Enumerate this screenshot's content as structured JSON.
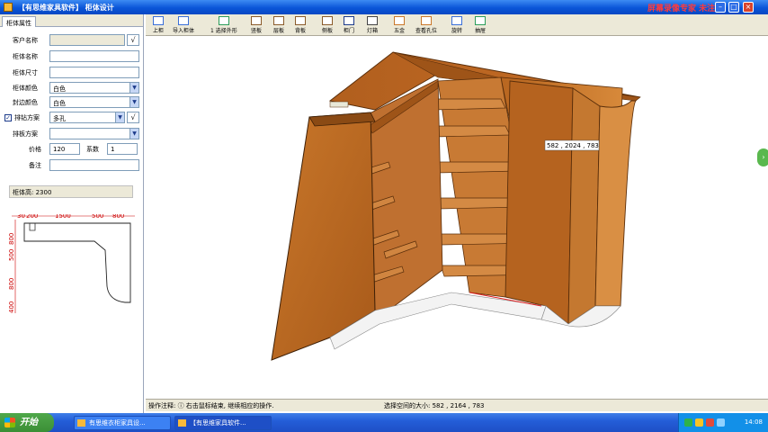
{
  "window": {
    "title": "【有思维家具软件】  柜体设计",
    "watermark": "屏幕录像专家 未注册"
  },
  "left_panel": {
    "tab": "柜体属性",
    "fields": {
      "customer_name": {
        "label": "客户名称",
        "value": ""
      },
      "cabinet_name": {
        "label": "柜体名称",
        "value": ""
      },
      "cabinet_size": {
        "label": "柜体尺寸",
        "value": ""
      },
      "cabinet_color": {
        "label": "柜体颜色",
        "value": "白色"
      },
      "trim_color": {
        "label": "封边颜色",
        "value": "白色"
      },
      "hole_mode": {
        "label": "排钻方案",
        "value": "多孔"
      },
      "sort_scheme": {
        "label": "排板方案",
        "value": ""
      },
      "price": {
        "label": "价格",
        "value": "120"
      },
      "coefficient": {
        "label": "系数",
        "value": "1"
      },
      "remark": {
        "label": "备注",
        "value": ""
      }
    },
    "cabinet_height": "柜体高: 2300",
    "floorplan": {
      "top_dims": [
        "30",
        "200",
        "1500",
        "500",
        "800"
      ],
      "left_dims": [
        "800",
        "500",
        "800",
        "400"
      ]
    }
  },
  "toolbar": [
    {
      "id": "prev",
      "label": "上柜"
    },
    {
      "id": "import",
      "label": "导入柜体"
    },
    {
      "id": "outline",
      "label": "1 选择外形"
    },
    {
      "id": "partition",
      "label": "竖板"
    },
    {
      "id": "shelf",
      "label": "层板"
    },
    {
      "id": "back",
      "label": "背板"
    },
    {
      "id": "side",
      "label": "侧板"
    },
    {
      "id": "door",
      "label": "柜门"
    },
    {
      "id": "lighting",
      "label": "灯箱"
    },
    {
      "id": "hardware",
      "label": "五金"
    },
    {
      "id": "view_hole",
      "label": "查看孔位"
    },
    {
      "id": "rotate",
      "label": "旋转"
    },
    {
      "id": "pan",
      "label": "抽屉"
    }
  ],
  "viewport": {
    "dimension_tag": "582 , 2024 , 783"
  },
  "status": {
    "hint": "操作注释: ⓘ 右击鼠标结束, 继续相应的操作.",
    "selection": "选择空间的大小: 582 , 2164 , 783"
  },
  "taskbar": {
    "start": "开始",
    "items": [
      "有思维衣柜家具设...",
      "【有思维家具软件..."
    ],
    "clock": "14:08"
  }
}
